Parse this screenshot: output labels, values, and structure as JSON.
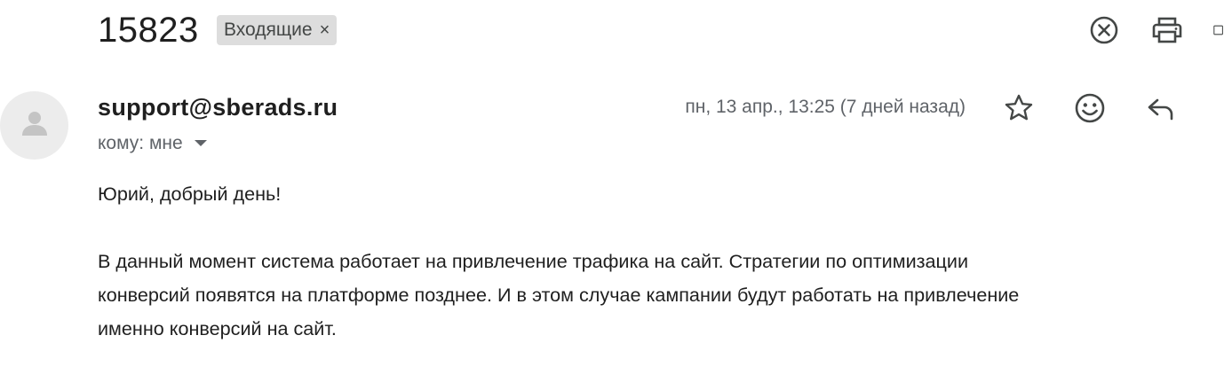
{
  "email": {
    "subject": "15823",
    "label": "Входящие",
    "label_remove": "×",
    "sender": "support@sberads.ru",
    "recipient_line": "кому: мне",
    "date": "пн, 13 апр., 13:25 (7 дней назад)",
    "greeting": "Юрий, добрый день!",
    "body_lines": [
      "В данный момент система работает на привлечение трафика на сайт. Стратегии по оптимизации",
      "конверсий появятся на платформе позднее. И в этом случае кампании будут работать на привлечение",
      "именно конверсий на сайт."
    ]
  },
  "icons": {
    "top": [
      "close-circle-icon",
      "print-icon",
      "open-new-window-icon"
    ],
    "header": [
      "star-icon",
      "emoji-icon",
      "reply-icon"
    ],
    "avatar": "person-icon",
    "recipient_toggle": "caret-down-icon"
  },
  "colors": {
    "chip_bg": "#dddddd",
    "muted_text": "#5f6368",
    "main_text": "#1f1f1f",
    "icon": "#444746"
  }
}
